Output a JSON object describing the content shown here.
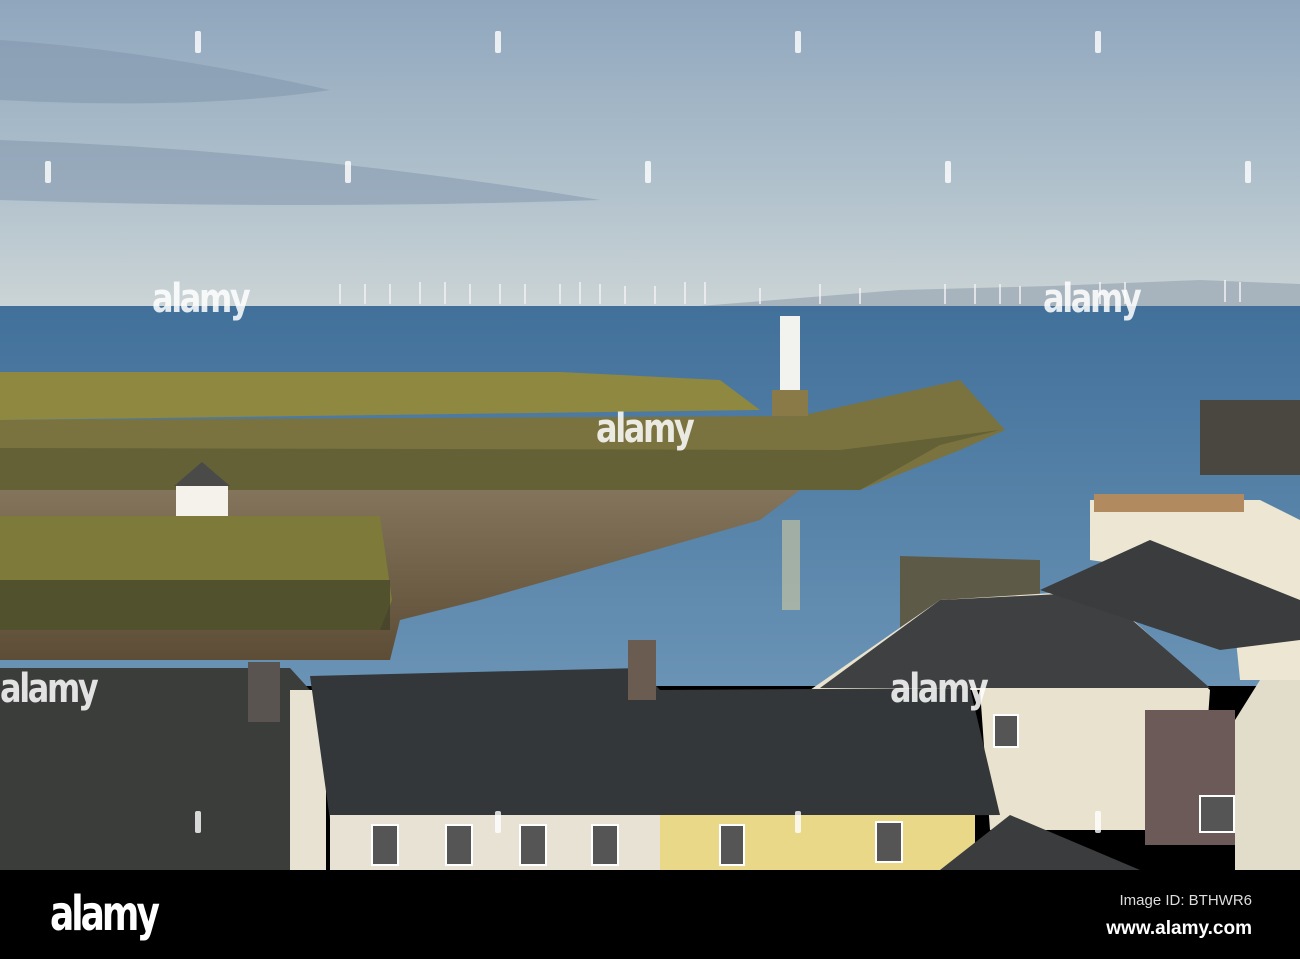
{
  "photo": {
    "subject": "harbour-with-lighthouse-and-offshore-wind-farm",
    "colors": {
      "sky_top": "#8fa6bd",
      "sky_horizon": "#c8d2d5",
      "sea": "#4d7ca4",
      "pier": "#8a8340",
      "mud": "#7b6a4e",
      "roof": "#36393b",
      "wall": "#e6e0c8"
    }
  },
  "watermark": {
    "text": "alamy"
  },
  "footer": {
    "logo": "alamy",
    "image_id": "Image ID: BTHWR6",
    "website": "www.alamy.com"
  }
}
